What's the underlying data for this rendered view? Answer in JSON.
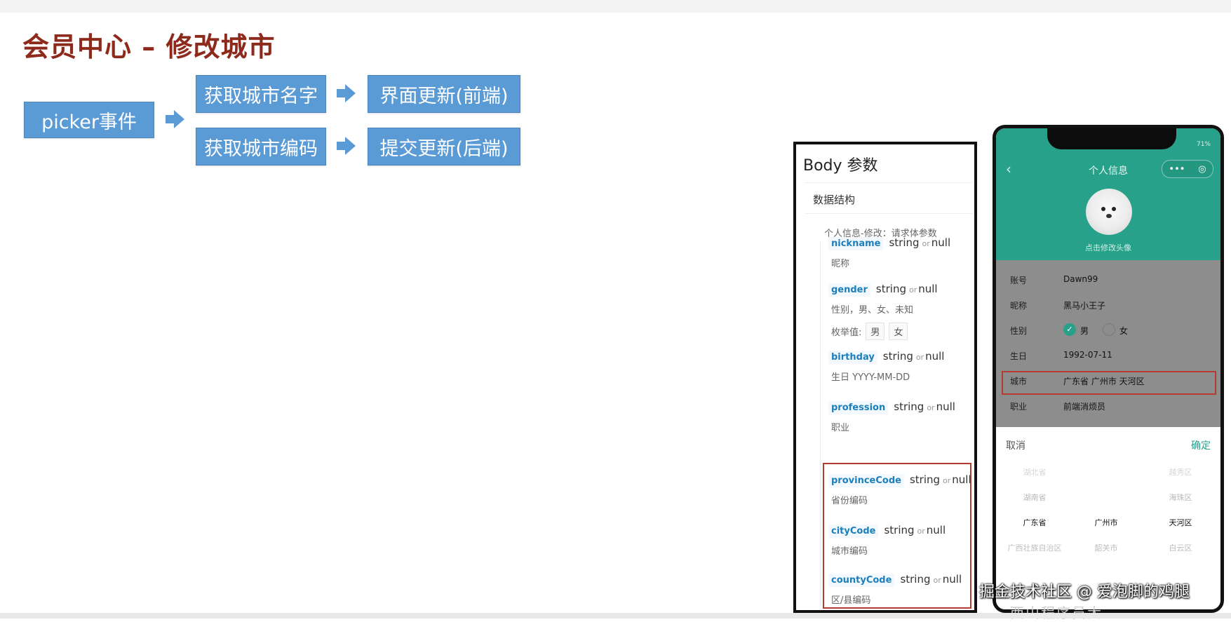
{
  "slide": {
    "title": "会员中心 – 修改城市"
  },
  "flow": {
    "start": "picker事件",
    "branch_top_1": "获取城市名字",
    "branch_top_2": "界面更新(前端)",
    "branch_bottom_1": "获取城市编码",
    "branch_bottom_2": "提交更新(后端)",
    "arrow_icon": "right-arrow-icon"
  },
  "api": {
    "title": "Body 参数",
    "section": "数据结构",
    "subtitle": "个人信息-修改：请求体参数",
    "type_label": "string",
    "or_label": "or",
    "null_label": "null",
    "enum_label": "枚举值:",
    "fields": [
      {
        "name": "nickname",
        "desc": "昵称"
      },
      {
        "name": "gender",
        "desc": "性别，男、女、未知",
        "enum": [
          "男",
          "女"
        ]
      },
      {
        "name": "birthday",
        "desc": "生日 YYYY-MM-DD"
      },
      {
        "name": "profession",
        "desc": "职业"
      },
      {
        "name": "provinceCode",
        "desc": "省份编码"
      },
      {
        "name": "cityCode",
        "desc": "城市编码"
      },
      {
        "name": "countyCode",
        "desc": "区/县编码"
      }
    ]
  },
  "phone": {
    "battery": "71%",
    "back_icon": "back-chevron-icon",
    "nav_title": "个人信息",
    "capsule_more": "•••",
    "capsule_close": "◎",
    "avatar_hint": "点击修改头像",
    "rows": [
      {
        "label": "账号",
        "value": "Dawn99"
      },
      {
        "label": "昵称",
        "value": "黑马小王子"
      },
      {
        "label": "性别",
        "male": "男",
        "female": "女"
      },
      {
        "label": "生日",
        "value": "1992-07-11"
      },
      {
        "label": "城市",
        "value": "广东省 广州市 天河区"
      },
      {
        "label": "职业",
        "value": "前端消烦员"
      }
    ],
    "picker": {
      "cancel": "取消",
      "confirm": "确定",
      "rows": [
        [
          "湖北省",
          "",
          "越秀区"
        ],
        [
          "湖南省",
          "",
          "海珠区"
        ],
        [
          "广东省",
          "广州市",
          "天河区"
        ],
        [
          "广西壮族自治区",
          "韶关市",
          "白云区"
        ]
      ]
    }
  },
  "watermark": "掘金技术社区 @ 爱泡脚的鸡腿",
  "bottom_strip": "西山程序员大..."
}
